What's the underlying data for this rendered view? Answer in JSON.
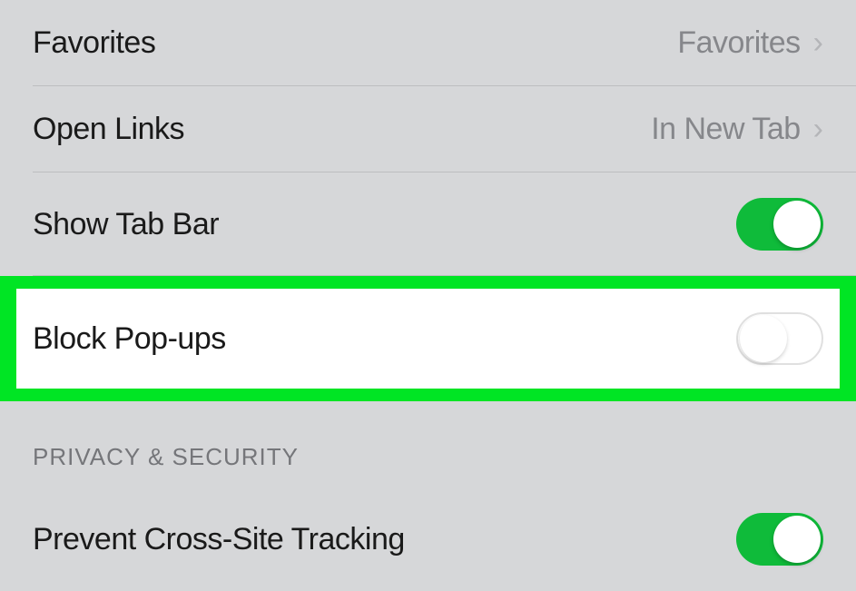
{
  "rows": {
    "favorites": {
      "label": "Favorites",
      "value": "Favorites"
    },
    "openLinks": {
      "label": "Open Links",
      "value": "In New Tab"
    },
    "showTabBar": {
      "label": "Show Tab Bar"
    },
    "blockPopups": {
      "label": "Block Pop-ups"
    },
    "preventCrossSite": {
      "label": "Prevent Cross-Site Tracking"
    }
  },
  "sections": {
    "privacySecurity": {
      "header": "PRIVACY & SECURITY"
    }
  }
}
